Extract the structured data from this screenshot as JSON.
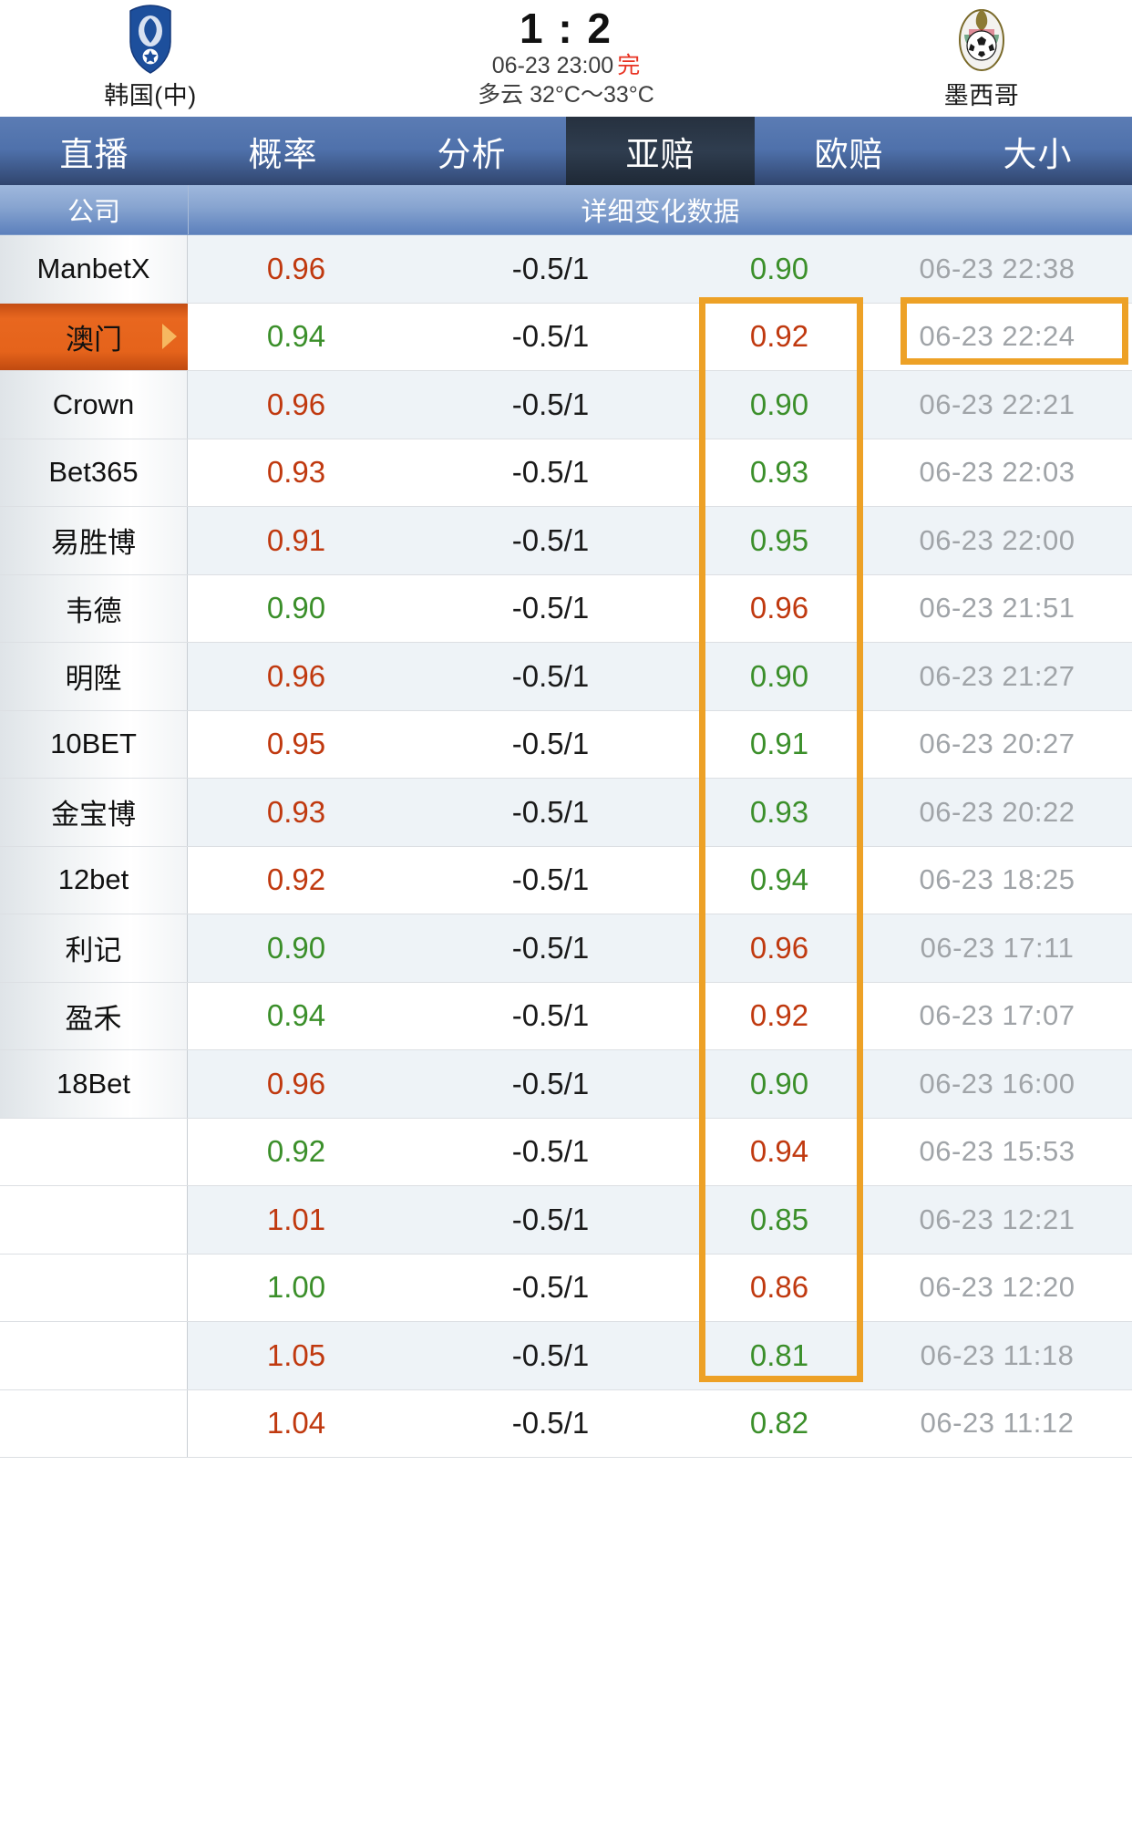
{
  "match": {
    "home": {
      "name": "韩国(中)",
      "logo": "korea-football-crest"
    },
    "away": {
      "name": "墨西哥",
      "logo": "mexico-football-crest"
    },
    "score": "1 : 2",
    "kickoff": "06-23 23:00",
    "status": "完",
    "weather": "多云 32°C～33°C"
  },
  "tabs": [
    {
      "label": "直播",
      "active": false
    },
    {
      "label": "概率",
      "active": false
    },
    {
      "label": "分析",
      "active": false
    },
    {
      "label": "亚赔",
      "active": true
    },
    {
      "label": "欧赔",
      "active": false
    },
    {
      "label": "大小",
      "active": false
    }
  ],
  "table": {
    "headers": {
      "company": "公司",
      "detail": "详细变化数据"
    },
    "rows": [
      {
        "company": "ManbetX",
        "home_odd": "0.96",
        "home_dir": "up",
        "handicap": "-0.5/1",
        "away_odd": "0.90",
        "away_dir": "down",
        "time": "06-23 22:38",
        "selected": false
      },
      {
        "company": "澳门",
        "home_odd": "0.94",
        "home_dir": "down",
        "handicap": "-0.5/1",
        "away_odd": "0.92",
        "away_dir": "up",
        "time": "06-23 22:24",
        "selected": true
      },
      {
        "company": "Crown",
        "home_odd": "0.96",
        "home_dir": "up",
        "handicap": "-0.5/1",
        "away_odd": "0.90",
        "away_dir": "down",
        "time": "06-23 22:21",
        "selected": false
      },
      {
        "company": "Bet365",
        "home_odd": "0.93",
        "home_dir": "up",
        "handicap": "-0.5/1",
        "away_odd": "0.93",
        "away_dir": "down",
        "time": "06-23 22:03",
        "selected": false
      },
      {
        "company": "易胜博",
        "home_odd": "0.91",
        "home_dir": "up",
        "handicap": "-0.5/1",
        "away_odd": "0.95",
        "away_dir": "down",
        "time": "06-23 22:00",
        "selected": false
      },
      {
        "company": "韦德",
        "home_odd": "0.90",
        "home_dir": "down",
        "handicap": "-0.5/1",
        "away_odd": "0.96",
        "away_dir": "up",
        "time": "06-23 21:51",
        "selected": false
      },
      {
        "company": "明陞",
        "home_odd": "0.96",
        "home_dir": "up",
        "handicap": "-0.5/1",
        "away_odd": "0.90",
        "away_dir": "down",
        "time": "06-23 21:27",
        "selected": false
      },
      {
        "company": "10BET",
        "home_odd": "0.95",
        "home_dir": "up",
        "handicap": "-0.5/1",
        "away_odd": "0.91",
        "away_dir": "down",
        "time": "06-23 20:27",
        "selected": false
      },
      {
        "company": "金宝博",
        "home_odd": "0.93",
        "home_dir": "up",
        "handicap": "-0.5/1",
        "away_odd": "0.93",
        "away_dir": "down",
        "time": "06-23 20:22",
        "selected": false
      },
      {
        "company": "12bet",
        "home_odd": "0.92",
        "home_dir": "up",
        "handicap": "-0.5/1",
        "away_odd": "0.94",
        "away_dir": "down",
        "time": "06-23 18:25",
        "selected": false
      },
      {
        "company": "利记",
        "home_odd": "0.90",
        "home_dir": "down",
        "handicap": "-0.5/1",
        "away_odd": "0.96",
        "away_dir": "up",
        "time": "06-23 17:11",
        "selected": false
      },
      {
        "company": "盈禾",
        "home_odd": "0.94",
        "home_dir": "down",
        "handicap": "-0.5/1",
        "away_odd": "0.92",
        "away_dir": "up",
        "time": "06-23 17:07",
        "selected": false
      },
      {
        "company": "18Bet",
        "home_odd": "0.96",
        "home_dir": "up",
        "handicap": "-0.5/1",
        "away_odd": "0.90",
        "away_dir": "down",
        "time": "06-23 16:00",
        "selected": false
      },
      {
        "company": "",
        "home_odd": "0.92",
        "home_dir": "down",
        "handicap": "-0.5/1",
        "away_odd": "0.94",
        "away_dir": "up",
        "time": "06-23 15:53",
        "selected": false
      },
      {
        "company": "",
        "home_odd": "1.01",
        "home_dir": "up",
        "handicap": "-0.5/1",
        "away_odd": "0.85",
        "away_dir": "down",
        "time": "06-23 12:21",
        "selected": false
      },
      {
        "company": "",
        "home_odd": "1.00",
        "home_dir": "down",
        "handicap": "-0.5/1",
        "away_odd": "0.86",
        "away_dir": "up",
        "time": "06-23 12:20",
        "selected": false
      },
      {
        "company": "",
        "home_odd": "1.05",
        "home_dir": "up",
        "handicap": "-0.5/1",
        "away_odd": "0.81",
        "away_dir": "down",
        "time": "06-23 11:18",
        "selected": false
      },
      {
        "company": "",
        "home_odd": "1.04",
        "home_dir": "up",
        "handicap": "-0.5/1",
        "away_odd": "0.82",
        "away_dir": "down",
        "time": "06-23 11:12",
        "selected": false
      }
    ]
  },
  "annotations": {
    "column_box_label": "away-odds-column-highlight",
    "time_box_label": "first-row-time-highlight",
    "color": "#eda126"
  },
  "colors": {
    "up": "#c0390f",
    "down": "#3b8f2a",
    "accent_orange": "#e5631b",
    "tab_blue": "#4f71ab",
    "header_blue": "#87a4d0"
  }
}
